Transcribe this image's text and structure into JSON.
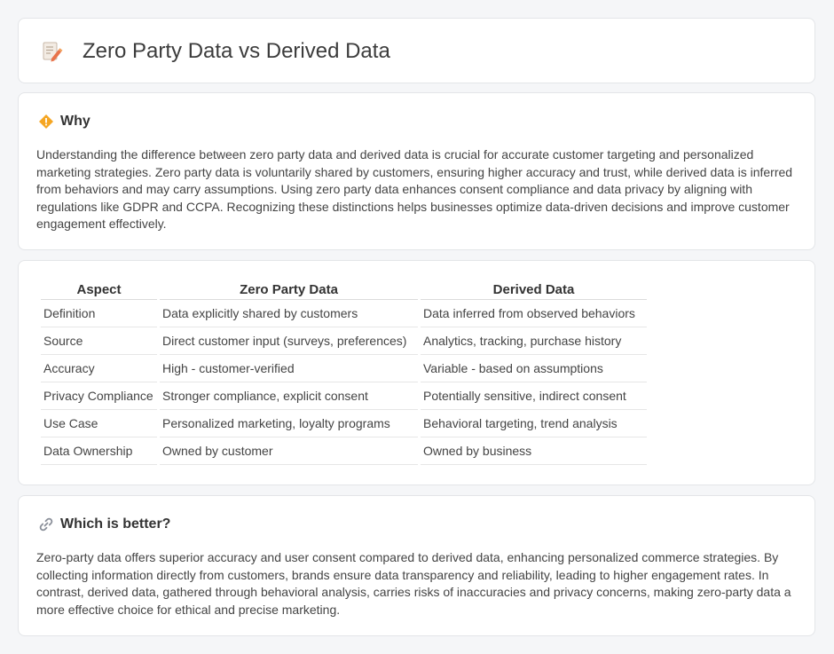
{
  "page": {
    "title": "Zero Party Data vs Derived Data"
  },
  "why": {
    "heading": "Why",
    "text": "Understanding the difference between zero party data and derived data is crucial for accurate customer targeting and personalized marketing strategies. Zero party data is voluntarily shared by customers, ensuring higher accuracy and trust, while derived data is inferred from behaviors and may carry assumptions. Using zero party data enhances consent compliance and data privacy by aligning with regulations like GDPR and CCPA. Recognizing these distinctions helps businesses optimize data-driven decisions and improve customer engagement effectively."
  },
  "table": {
    "headers": [
      "Aspect",
      "Zero Party Data",
      "Derived Data"
    ],
    "rows": [
      [
        "Definition",
        "Data explicitly shared by customers",
        "Data inferred from observed behaviors"
      ],
      [
        "Source",
        "Direct customer input (surveys, preferences)",
        "Analytics, tracking, purchase history"
      ],
      [
        "Accuracy",
        "High - customer-verified",
        "Variable - based on assumptions"
      ],
      [
        "Privacy Compliance",
        "Stronger compliance, explicit consent",
        "Potentially sensitive, indirect consent"
      ],
      [
        "Use Case",
        "Personalized marketing, loyalty programs",
        "Behavioral targeting, trend analysis"
      ],
      [
        "Data Ownership",
        "Owned by customer",
        "Owned by business"
      ]
    ]
  },
  "better": {
    "heading": "Which is better?",
    "text": "Zero-party data offers superior accuracy and user consent compared to derived data, enhancing personalized commerce strategies. By collecting information directly from customers, brands ensure data transparency and reliability, leading to higher engagement rates. In contrast, derived data, gathered through behavioral analysis, carries risks of inaccuracies and privacy concerns, making zero-party data a more effective choice for ethical and precise marketing."
  },
  "icons": {
    "title": "document-pencil-icon",
    "why": "warning-diamond-icon",
    "better": "link-icon"
  }
}
